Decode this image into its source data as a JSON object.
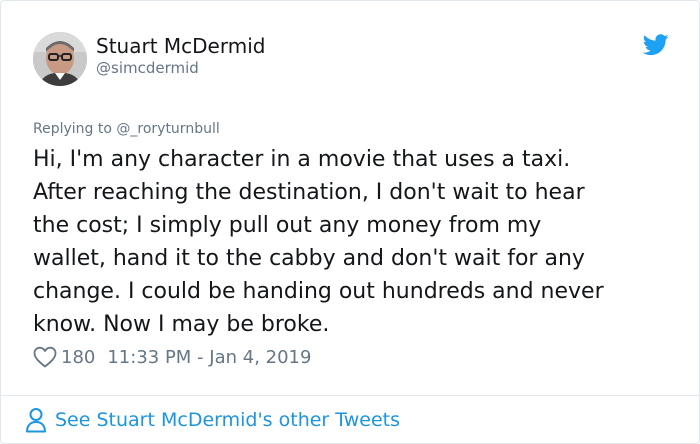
{
  "author": {
    "name": "Stuart McDermid",
    "handle": "@simcdermid"
  },
  "reply": {
    "prefix": "Replying to ",
    "to": "@_roryturnbull"
  },
  "tweet": {
    "text": "Hi, I'm any character in a movie that uses a taxi.\nAfter reaching the destination, I don't wait to hear\nthe cost; I simply pull out any money from my\nwallet, hand it to the cabby and don't wait for any\nchange. I could be handing out hundreds and never\nknow. Now I may be broke."
  },
  "meta": {
    "likes": "180",
    "timestamp": "11:33 PM - Jan 4, 2019"
  },
  "footer": {
    "label": "See Stuart McDermid's other Tweets"
  },
  "icons": {
    "bird": "twitter-bird-icon",
    "heart": "heart-icon",
    "person": "person-icon"
  },
  "colors": {
    "brand": "#1da1f2",
    "link": "#1b95e0",
    "muted": "#657786",
    "text": "#14171a"
  }
}
